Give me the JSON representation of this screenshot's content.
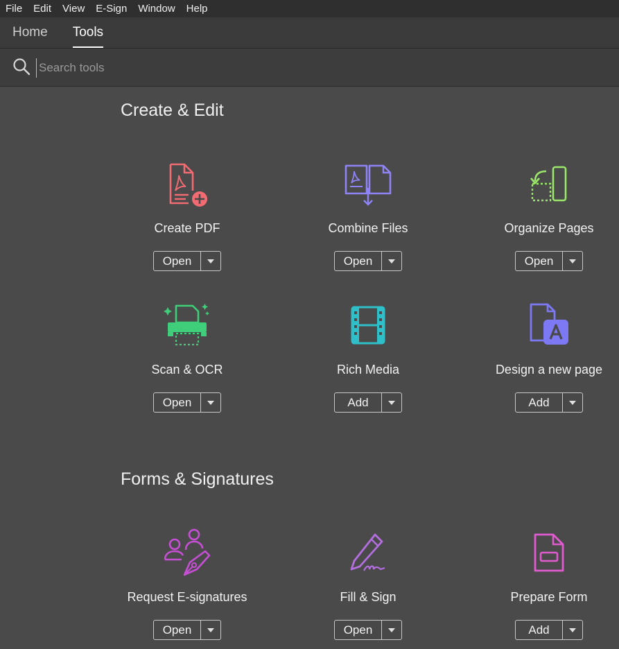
{
  "menubar": {
    "items": [
      "File",
      "Edit",
      "View",
      "E-Sign",
      "Window",
      "Help"
    ]
  },
  "tabs": [
    {
      "label": "Home",
      "active": false
    },
    {
      "label": "Tools",
      "active": true
    }
  ],
  "search": {
    "placeholder": "Search tools",
    "value": ""
  },
  "sections": [
    {
      "title": "Create & Edit",
      "tools": [
        {
          "name": "Create PDF",
          "action": "Open",
          "icon": "create-pdf-icon",
          "color": "#f26b73"
        },
        {
          "name": "Combine Files",
          "action": "Open",
          "icon": "combine-files-icon",
          "color": "#8f84f5"
        },
        {
          "name": "Organize Pages",
          "action": "Open",
          "icon": "organize-pages-icon",
          "color": "#9be86a"
        },
        {
          "name": "Scan & OCR",
          "action": "Open",
          "icon": "scan-ocr-icon",
          "color": "#3fcf7a"
        },
        {
          "name": "Rich Media",
          "action": "Add",
          "icon": "rich-media-icon",
          "color": "#2fbfc9"
        },
        {
          "name": "Design a new page",
          "action": "Add",
          "icon": "design-page-icon",
          "color": "#7d79f5"
        }
      ]
    },
    {
      "title": "Forms & Signatures",
      "tools": [
        {
          "name": "Request E-signatures",
          "action": "Open",
          "icon": "request-esignatures-icon",
          "color": "#c74fd6"
        },
        {
          "name": "Fill & Sign",
          "action": "Open",
          "icon": "fill-sign-icon",
          "color": "#b36ee0"
        },
        {
          "name": "Prepare Form",
          "action": "Add",
          "icon": "prepare-form-icon",
          "color": "#e05ad0"
        }
      ]
    }
  ]
}
